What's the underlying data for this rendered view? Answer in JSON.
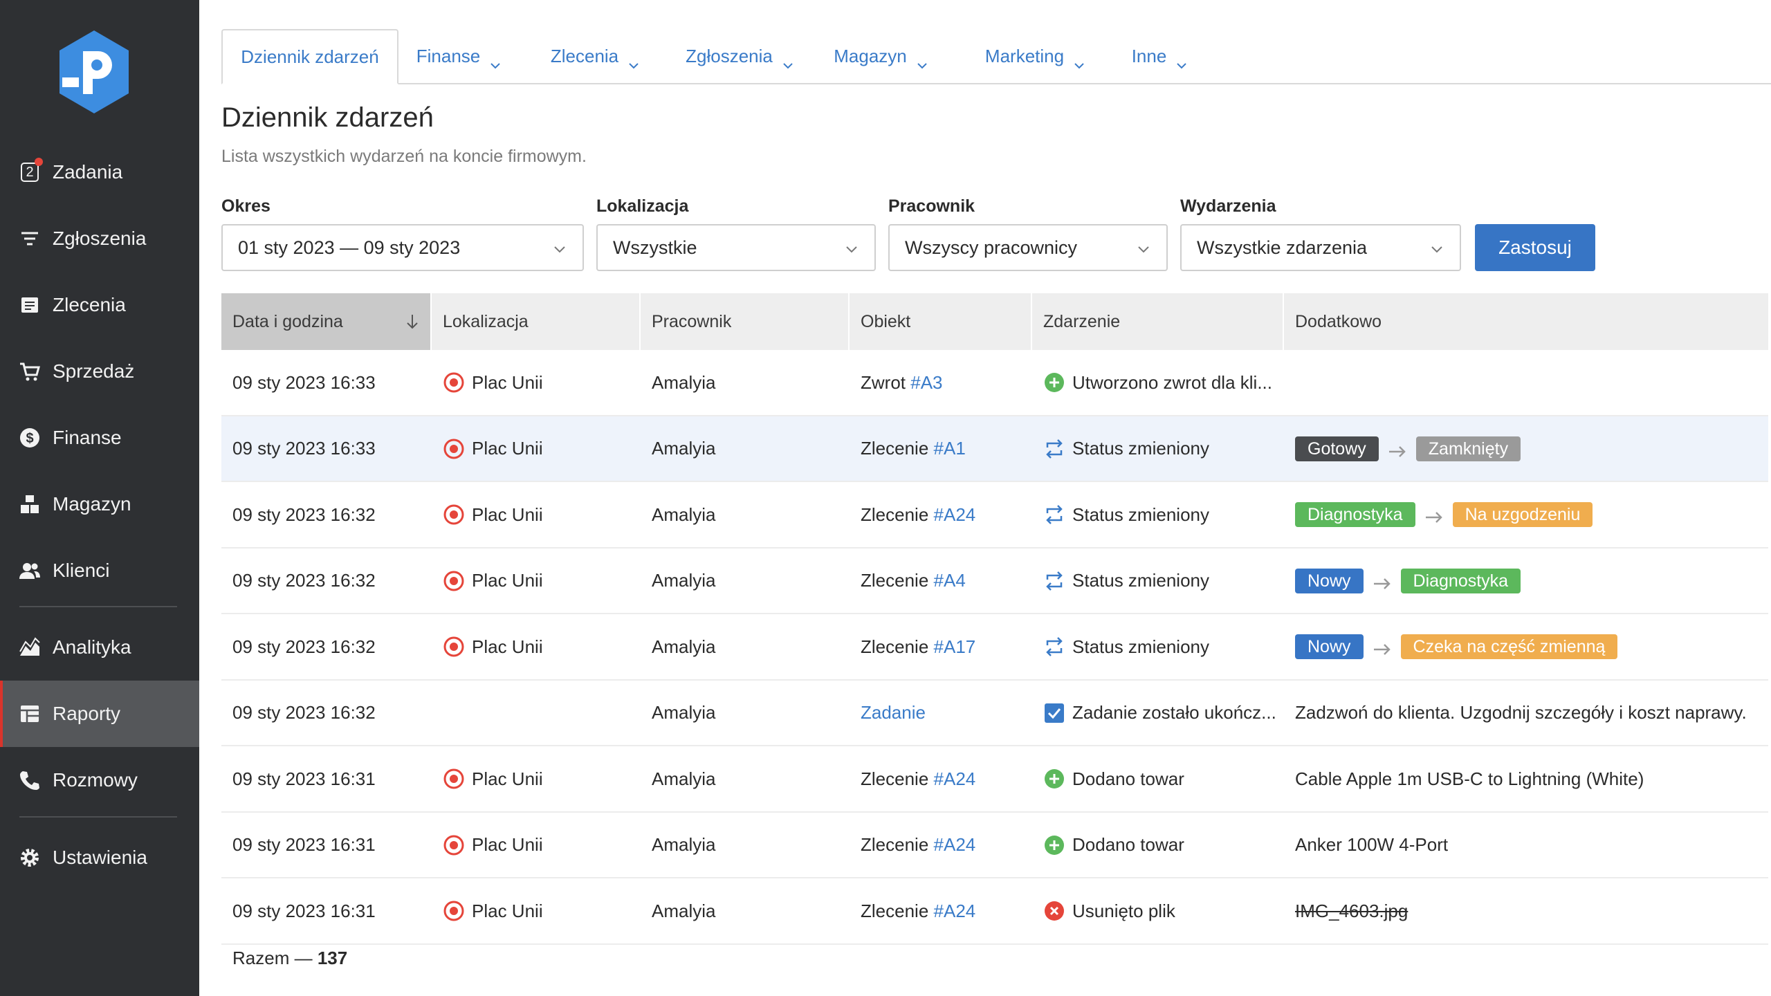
{
  "colors": {
    "accent": "#3775c5",
    "link": "#3a7bc8",
    "sidebar_bg": "#2e3033",
    "active_marker": "#d9342b",
    "pill_dark": "#4a4c4f",
    "pill_grey": "#9a9a9a",
    "pill_green": "#5cb85c",
    "pill_orange": "#f0ad4e",
    "pill_blue": "#3775c5"
  },
  "sidebar": {
    "logo": "app-logo",
    "items": [
      {
        "label": "Zadania",
        "icon": "tasks-icon",
        "badge": "2"
      },
      {
        "label": "Zgłoszenia",
        "icon": "filter-icon"
      },
      {
        "label": "Zlecenia",
        "icon": "document-icon"
      },
      {
        "label": "Sprzedaż",
        "icon": "cart-icon"
      },
      {
        "label": "Finanse",
        "icon": "dollar-icon"
      },
      {
        "label": "Magazyn",
        "icon": "boxes-icon"
      },
      {
        "label": "Klienci",
        "icon": "users-icon"
      },
      {
        "label": "Analityka",
        "icon": "chart-icon"
      },
      {
        "label": "Raporty",
        "icon": "table-icon",
        "active": true
      },
      {
        "label": "Rozmowy",
        "icon": "phone-icon"
      },
      {
        "label": "Ustawienia",
        "icon": "gear-icon"
      }
    ]
  },
  "tabs": [
    {
      "label": "Dziennik zdarzeń",
      "active": true
    },
    {
      "label": "Finanse"
    },
    {
      "label": "Zlecenia"
    },
    {
      "label": "Zgłoszenia"
    },
    {
      "label": "Magazyn"
    },
    {
      "label": "Marketing"
    },
    {
      "label": "Inne"
    }
  ],
  "page": {
    "title": "Dziennik zdarzeń",
    "subtitle": "Lista wszystkich wydarzeń na koncie firmowym."
  },
  "filters": {
    "period": {
      "label": "Okres",
      "value": "01 sty 2023 — 09 sty 2023"
    },
    "location": {
      "label": "Lokalizacja",
      "value": "Wszystkie"
    },
    "employee": {
      "label": "Pracownik",
      "value": "Wszyscy pracownicy"
    },
    "events": {
      "label": "Wydarzenia",
      "value": "Wszystkie zdarzenia"
    },
    "apply_label": "Zastosuj"
  },
  "table": {
    "columns": [
      "Data i godzina",
      "Lokalizacja",
      "Pracownik",
      "Obiekt",
      "Zdarzenie",
      "Dodatkowo"
    ],
    "rows": [
      {
        "date": "09 sty 2023 16:33",
        "location": "Plac Unii",
        "employee": "Amalyia",
        "object_prefix": "Zwrot",
        "object_link": "#A3",
        "event_icon": "plus-circle-icon",
        "event": "Utworzono zwrot dla kli...",
        "extra_type": "none"
      },
      {
        "date": "09 sty 2023 16:33",
        "location": "Plac Unii",
        "employee": "Amalyia",
        "object_prefix": "Zlecenie",
        "object_link": "#A1",
        "event_icon": "status-change-icon",
        "event": "Status zmieniony",
        "extra_type": "status",
        "from": "Gotowy",
        "from_color": "#4a4c4f",
        "to": "Zamknięty",
        "to_color": "#9a9a9a",
        "highlight": true
      },
      {
        "date": "09 sty 2023 16:32",
        "location": "Plac Unii",
        "employee": "Amalyia",
        "object_prefix": "Zlecenie",
        "object_link": "#A24",
        "event_icon": "status-change-icon",
        "event": "Status zmieniony",
        "extra_type": "status",
        "from": "Diagnostyka",
        "from_color": "#5cb85c",
        "to": "Na uzgodzeniu",
        "to_color": "#f0ad4e"
      },
      {
        "date": "09 sty 2023 16:32",
        "location": "Plac Unii",
        "employee": "Amalyia",
        "object_prefix": "Zlecenie",
        "object_link": "#A4",
        "event_icon": "status-change-icon",
        "event": "Status zmieniony",
        "extra_type": "status",
        "from": "Nowy",
        "from_color": "#3775c5",
        "to": "Diagnostyka",
        "to_color": "#5cb85c"
      },
      {
        "date": "09 sty 2023 16:32",
        "location": "Plac Unii",
        "employee": "Amalyia",
        "object_prefix": "Zlecenie",
        "object_link": "#A17",
        "event_icon": "status-change-icon",
        "event": "Status zmieniony",
        "extra_type": "status",
        "from": "Nowy",
        "from_color": "#3775c5",
        "to": "Czeka na część zmienną",
        "to_color": "#f0ad4e"
      },
      {
        "date": "09 sty 2023 16:32",
        "location": "",
        "employee": "Amalyia",
        "object_prefix": "",
        "object_link": "Zadanie",
        "event_icon": "checkbox-icon",
        "event": "Zadanie zostało ukończ...",
        "extra_type": "text",
        "extra": "Zadzwoń do klienta. Uzgodnij szczegóły i koszt naprawy."
      },
      {
        "date": "09 sty 2023 16:31",
        "location": "Plac Unii",
        "employee": "Amalyia",
        "object_prefix": "Zlecenie",
        "object_link": "#A24",
        "event_icon": "plus-circle-icon",
        "event": "Dodano towar",
        "extra_type": "text",
        "extra": "Cable Apple 1m USB-C to Lightning (White)"
      },
      {
        "date": "09 sty 2023 16:31",
        "location": "Plac Unii",
        "employee": "Amalyia",
        "object_prefix": "Zlecenie",
        "object_link": "#A24",
        "event_icon": "plus-circle-icon",
        "event": "Dodano towar",
        "extra_type": "text",
        "extra": "Anker 100W 4-Port"
      },
      {
        "date": "09 sty 2023 16:31",
        "location": "Plac Unii",
        "employee": "Amalyia",
        "object_prefix": "Zlecenie",
        "object_link": "#A24",
        "event_icon": "remove-circle-icon",
        "event": "Usunięto plik",
        "extra_type": "strike",
        "extra": "IMG_4603.jpg"
      }
    ]
  },
  "footer": {
    "total_label": "Razem —",
    "total_value": "137"
  }
}
